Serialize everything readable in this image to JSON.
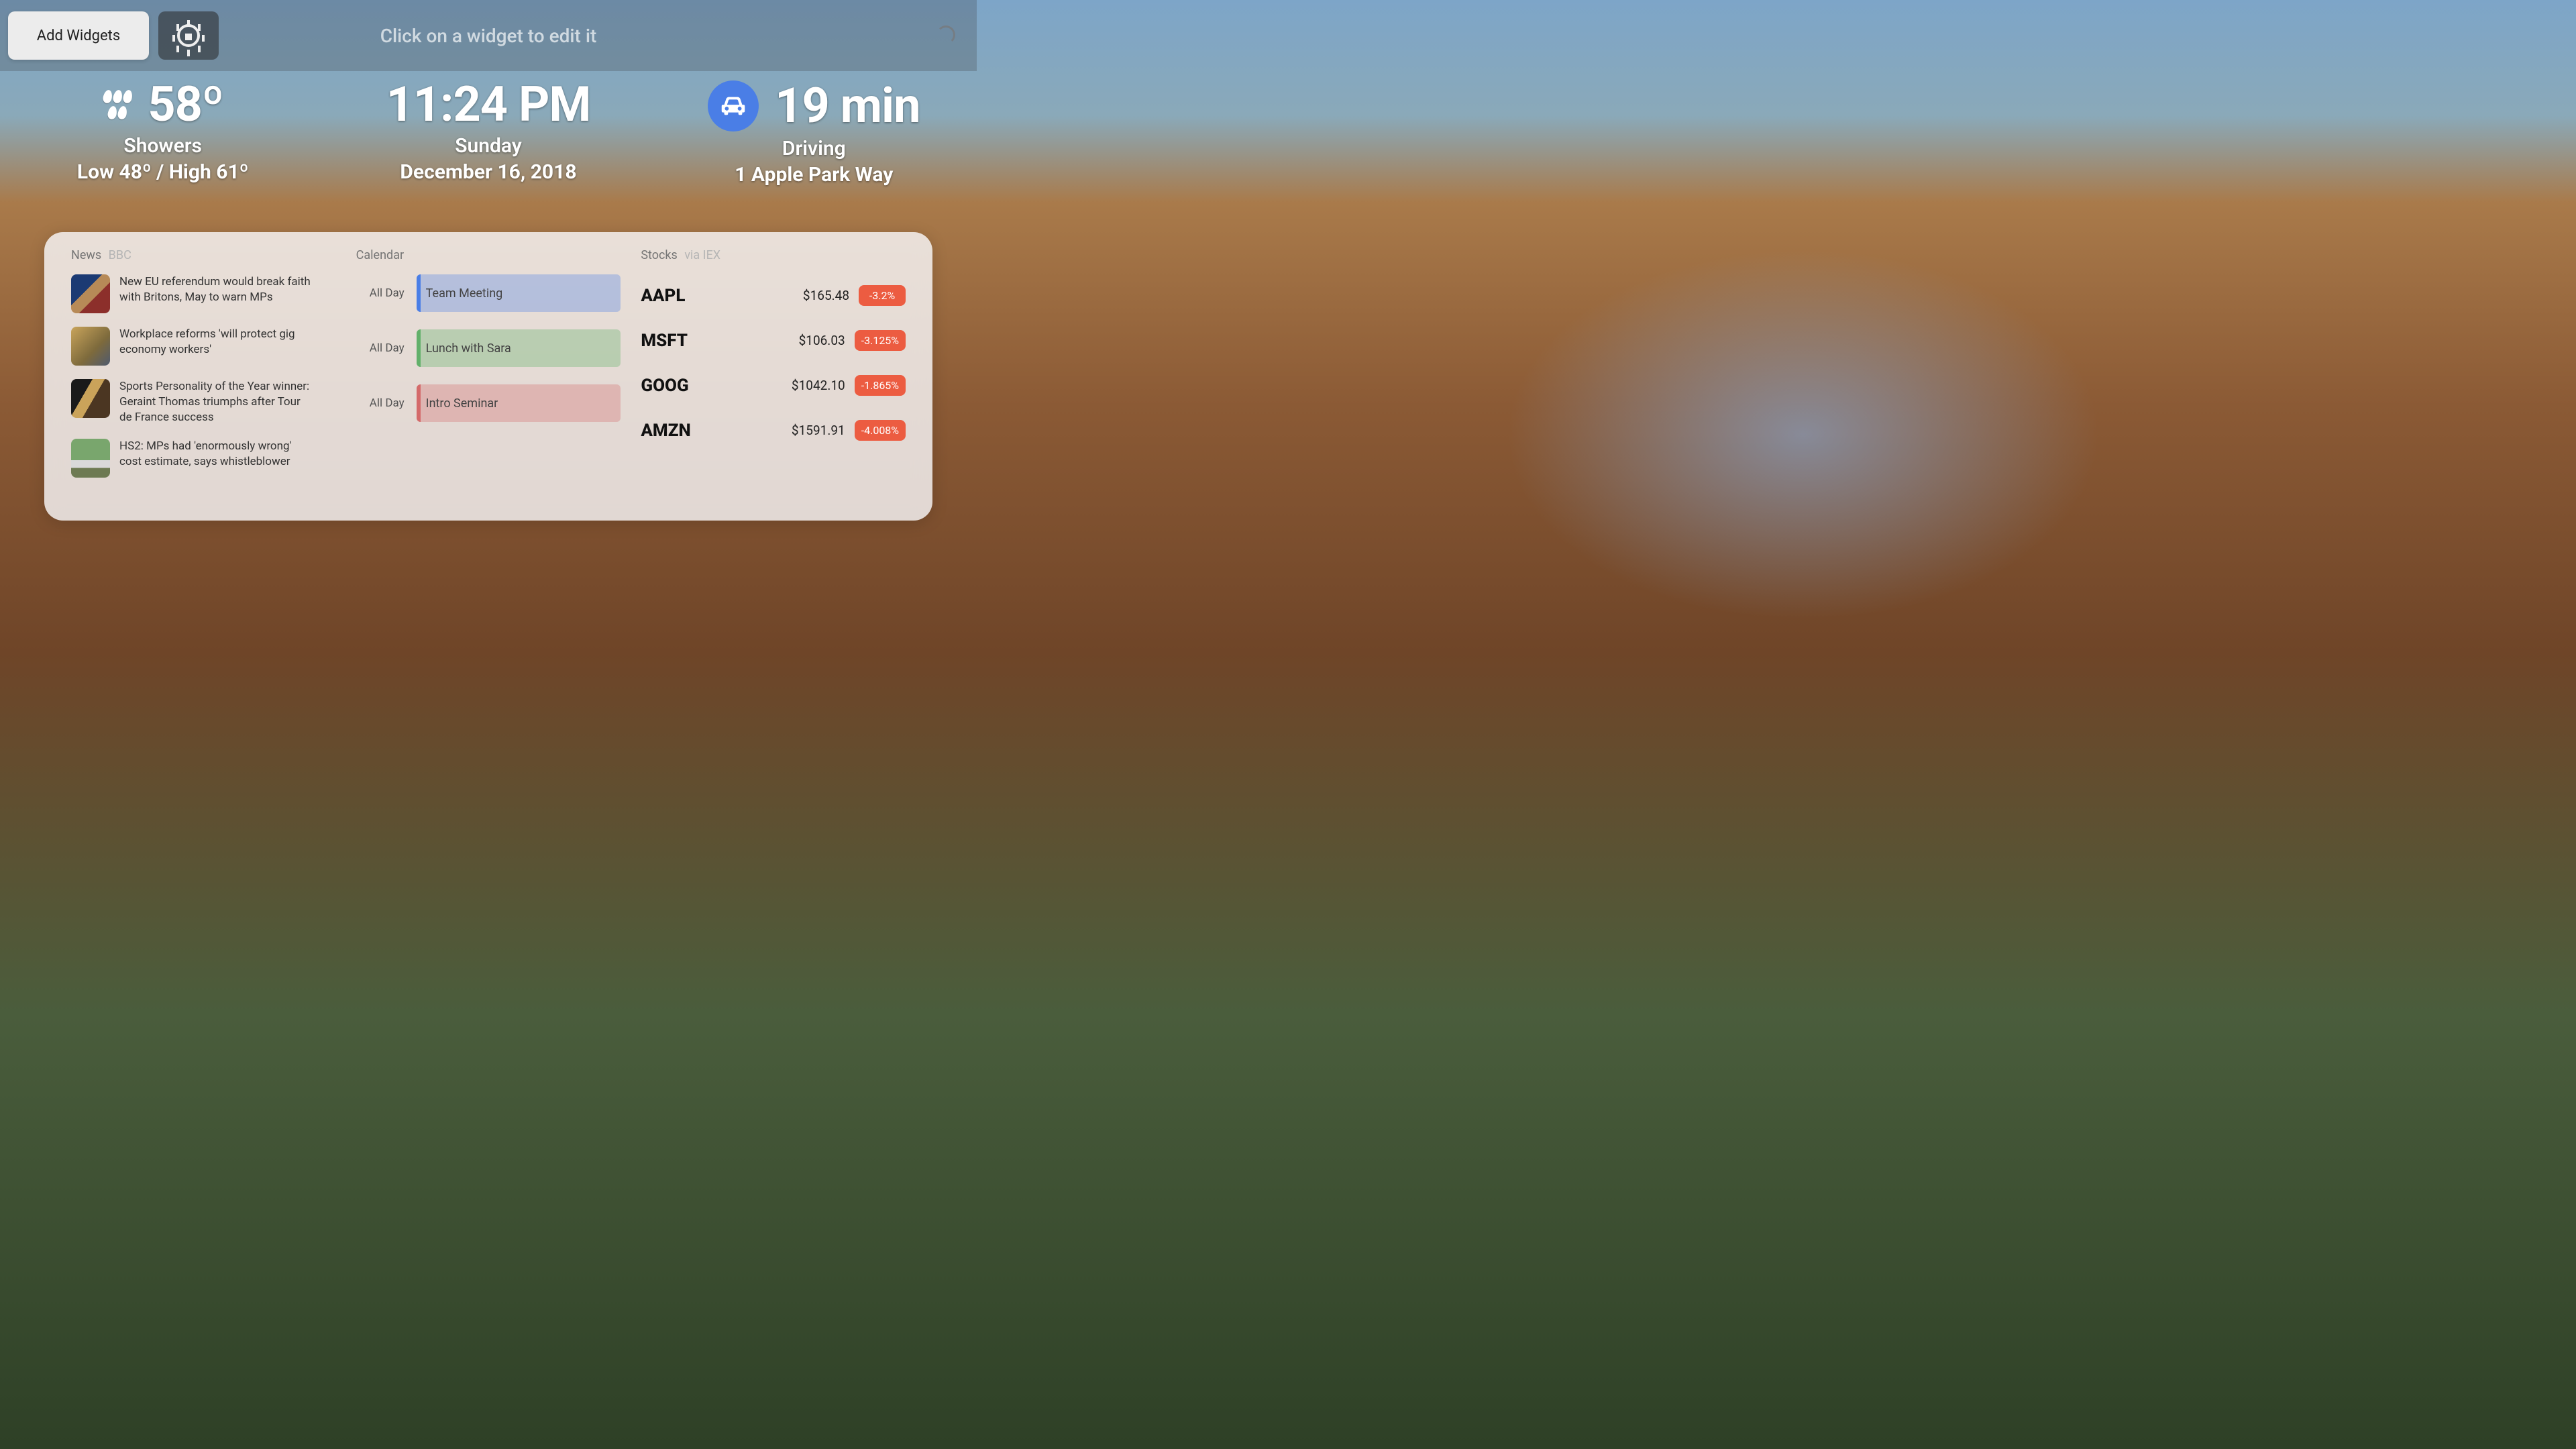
{
  "toolbar": {
    "add_label": "Add Widgets",
    "hint": "Click on a widget to edit it"
  },
  "weather": {
    "temp": "58º",
    "condition": "Showers",
    "range": "Low 48º / High 61º"
  },
  "clock": {
    "time": "11:24 PM",
    "weekday": "Sunday",
    "date": "December 16, 2018"
  },
  "commute": {
    "duration": "19 min",
    "mode": "Driving",
    "destination": "1 Apple Park Way"
  },
  "news": {
    "title": "News",
    "source": "BBC",
    "items": [
      {
        "headline": "New EU referendum would break faith with Britons, May to warn MPs",
        "thumb_bg": "linear-gradient(135deg,#1b3a73 0%,#1b3a73 40%,#b78a57 40%,#b78a57 60%,#8c2f2b 60%)"
      },
      {
        "headline": "Workplace reforms 'will protect gig economy workers'",
        "thumb_bg": "linear-gradient(135deg,#c9a45b,#7d6a3c 60%,#4f5a6f)"
      },
      {
        "headline": "Sports Personality of the Year winner: Geraint Thomas triumphs after Tour de France success",
        "thumb_bg": "linear-gradient(120deg,#1a1a1a 0%,#1a1a1a 35%,#caa35a 35%,#caa35a 55%,#4b3622 55%)"
      },
      {
        "headline": "HS2: MPs had 'enormously wrong' cost estimate, says whistleblower",
        "thumb_bg": "linear-gradient(180deg,#79a66d 0%,#79a66d 55%,#d9d9d9 55%,#d9d9d9 75%,#6d7a52 75%)"
      }
    ]
  },
  "calendar": {
    "title": "Calendar",
    "events": [
      {
        "time": "All Day",
        "title": "Team Meeting",
        "accent": "#4a7ee6",
        "bg": "rgba(74,126,230,0.32)"
      },
      {
        "time": "All Day",
        "title": "Lunch with Sara",
        "accent": "#62b06a",
        "bg": "rgba(98,176,106,0.34)"
      },
      {
        "time": "All Day",
        "title": "Intro Seminar",
        "accent": "#d46a6a",
        "bg": "rgba(212,106,106,0.32)"
      }
    ]
  },
  "stocks": {
    "title": "Stocks",
    "source": "via IEX",
    "items": [
      {
        "symbol": "AAPL",
        "price": "$165.48",
        "change": "-3.2%"
      },
      {
        "symbol": "MSFT",
        "price": "$106.03",
        "change": "-3.125%"
      },
      {
        "symbol": "GOOG",
        "price": "$1042.10",
        "change": "-1.865%"
      },
      {
        "symbol": "AMZN",
        "price": "$1591.91",
        "change": "-4.008%"
      }
    ]
  }
}
